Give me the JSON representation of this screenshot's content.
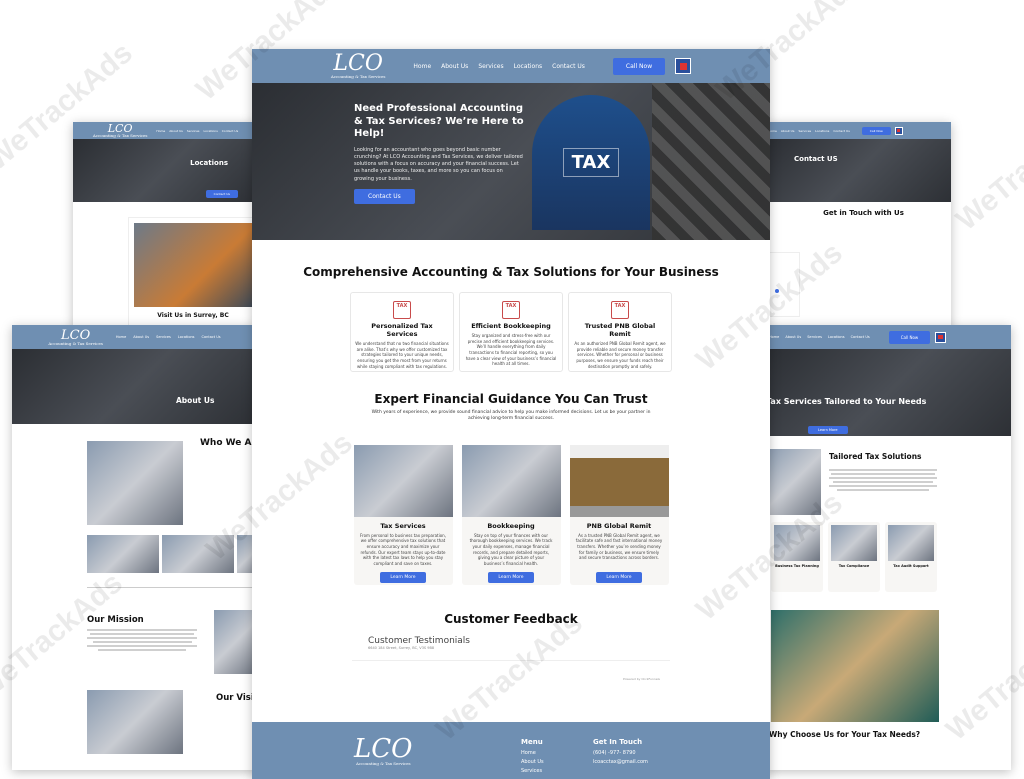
{
  "brand": {
    "logo_text": "LCO",
    "logo_subtitle": "Accounting & Tax Services",
    "accent_color": "#3f6de0",
    "nav_color": "#6f8fb2"
  },
  "nav": {
    "items": [
      "Home",
      "About Us",
      "Services",
      "Locations",
      "Contact Us"
    ],
    "call_label": "Call Now"
  },
  "watermark": "WeTrackAds",
  "home": {
    "hero": {
      "title": "Need Professional Accounting & Tax Services? We’re Here to Help!",
      "body": "Looking for an accountant who goes beyond basic number crunching? At LCO Accounting and Tax Services, we deliver tailored solutions with a focus on accuracy and your financial success. Let us handle your books, taxes, and more so you can focus on growing your business.",
      "cta": "Contact Us",
      "image_text": "TAX"
    },
    "solutions": {
      "title": "Comprehensive Accounting & Tax Solutions for Your Business",
      "icon_label": "TAX",
      "cards": [
        {
          "title": "Personalized Tax Services",
          "body": "We understand that no two financial situations are alike. That’s why we offer customized tax strategies tailored to your unique needs, ensuring you get the most from your returns while staying compliant with tax regulations."
        },
        {
          "title": "Efficient Bookkeeping",
          "body": "Stay organized and stress-free with our precise and efficient bookkeeping services. We’ll handle everything from daily transactions to financial reporting, so you have a clear view of your business’s financial health at all times."
        },
        {
          "title": "Trusted PNB Global Remit",
          "body": "As an authorized PNB Global Remit agent, we provide reliable and secure money transfer services. Whether for personal or business purposes, we ensure your funds reach their destination promptly and safely."
        }
      ]
    },
    "guidance": {
      "title": "Expert Financial Guidance You Can Trust",
      "body": "With years of experience, we provide sound financial advice to help you make informed decisions. Let us be your partner in achieving long-term financial success."
    },
    "services": [
      {
        "title": "Tax Services",
        "body": "From personal to business tax preparation, we offer comprehensive tax solutions that ensure accuracy and maximize your refunds. Our expert team stays up-to-date with the latest tax laws to help you stay compliant and save on taxes.",
        "cta": "Learn More"
      },
      {
        "title": "Bookkeeping",
        "body": "Stay on top of your finances with our thorough bookkeeping services. We track your daily expenses, manage financial records, and prepare detailed reports, giving you a clear picture of your business’s financial health.",
        "cta": "Learn More"
      },
      {
        "title": "PNB Global Remit",
        "body": "As a trusted PNB Global Remit agent, we facilitate safe and fast international money transfers. Whether you’re sending money for family or business, we ensure timely and secure transactions across borders.",
        "cta": "Learn More"
      }
    ],
    "feedback": {
      "title": "Customer Feedback",
      "widget_title": "Customer Testimonials",
      "address": "6640 184 Street, Surrey, BC, V3S 9B8",
      "powered_by": "Powered by ClickFunnels"
    },
    "footer": {
      "menu_title": "Menu",
      "menu_items": [
        "Home",
        "About Us",
        "Services"
      ],
      "contact_title": "Get In Touch",
      "phone": "(604) -977- 8790",
      "email": "lcoacctax@gmail.com"
    }
  },
  "locations_page": {
    "hero_title": "Locations",
    "cta": "Contact Us",
    "card_title": "Visit Us in Surrey, BC"
  },
  "about_page": {
    "hero_title": "About Us",
    "who_title": "Who We Are",
    "mission_title": "Our Mission",
    "vision_title": "Our Vision"
  },
  "contact_page": {
    "hero_title": "Contact US",
    "section_title": "Get in Touch with Us"
  },
  "tax_page": {
    "hero_title": "Tax Services Tailored to Your Needs",
    "cta": "Learn More",
    "section_title": "Tailored Tax Solutions",
    "cards": [
      "Business Tax Planning",
      "Tax Compliance",
      "Tax Audit Support"
    ],
    "choose_title": "Why Choose Us for Your Tax Needs?"
  }
}
